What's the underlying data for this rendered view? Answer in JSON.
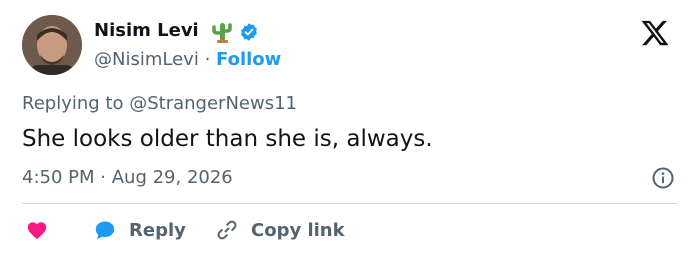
{
  "author": {
    "name": "Nisim Levi",
    "handle": "@NisimLevi",
    "separator": "·",
    "follow_label": "Follow",
    "name_emoji_icon": "cactus-icon",
    "verified_icon": "verified-badge-icon"
  },
  "reply_context": {
    "prefix": "Replying to",
    "mention": "@StrangerNews11"
  },
  "tweet": {
    "text": "She looks older than she is, always.",
    "time": "4:50 PM",
    "date_separator": "·",
    "date": "Aug 29, 2026"
  },
  "actions": {
    "like_icon": "heart-icon",
    "reply_label": "Reply",
    "reply_icon": "reply-bubble-icon",
    "copy_label": "Copy link",
    "copy_icon": "link-icon"
  },
  "colors": {
    "accent": "#1d9bf0",
    "heart": "#f91880",
    "muted": "#536471",
    "text": "#0f1419",
    "divider": "#cfd9de"
  }
}
